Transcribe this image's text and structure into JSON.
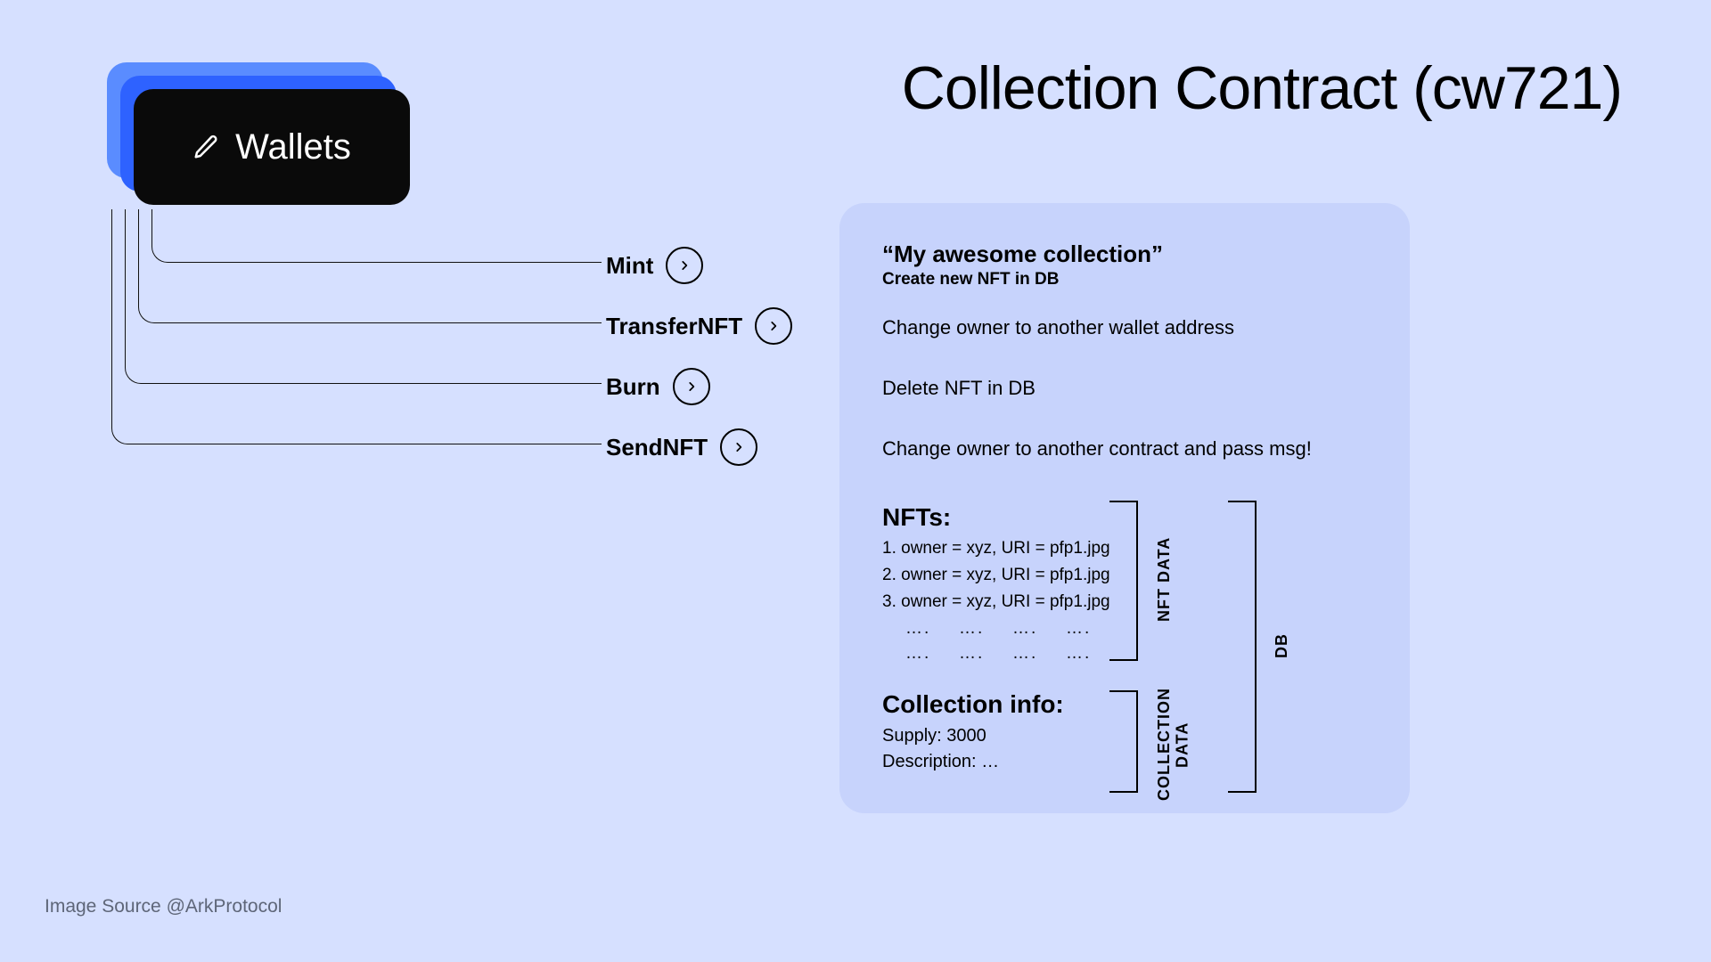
{
  "title": "Collection Contract (cw721)",
  "wallets_label": "Wallets",
  "actions": {
    "mint": "Mint",
    "transfer": "TransferNFT",
    "burn": "Burn",
    "send": "SendNFT"
  },
  "panel": {
    "mint": {
      "title": "“My awesome collection”",
      "sub": "Create new NFT in DB"
    },
    "transfer": "Change owner to another wallet address",
    "burn": "Delete NFT in DB",
    "send": "Change owner to another contract and pass msg!",
    "nfts": {
      "title": "NFTs:",
      "items": [
        "1. owner = xyz, URI = pfp1.jpg",
        "2. owner = xyz, URI = pfp1.jpg",
        "3. owner = xyz, URI = pfp1.jpg"
      ],
      "ellipsis": "…."
    },
    "collection_info": {
      "title": "Collection info:",
      "supply_label": "Supply:",
      "supply_value": "3000",
      "description_label": "Description:",
      "description_value": "…"
    }
  },
  "bracket_labels": {
    "nft": "NFT DATA",
    "collection": "COLLECTION DATA",
    "db": "DB"
  },
  "credit": "Image Source @ArkProtocol"
}
